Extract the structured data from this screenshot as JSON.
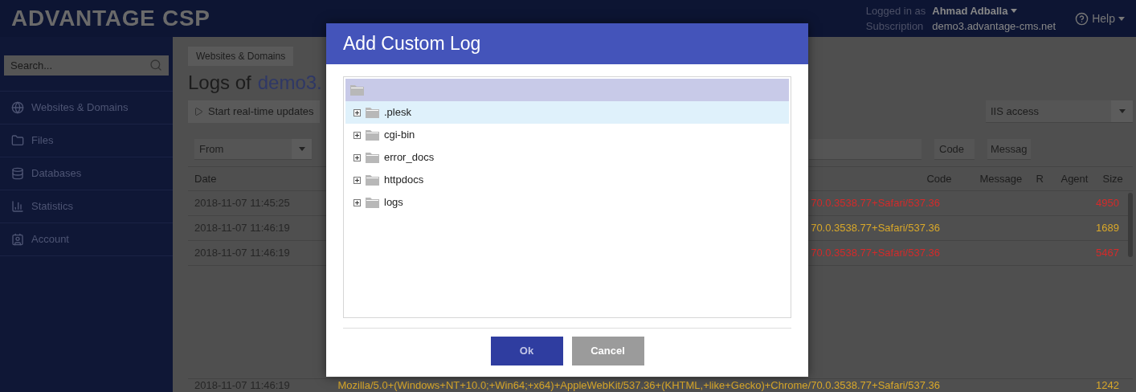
{
  "header": {
    "logo": "ADVANTAGE CSP",
    "logged_in_label": "Logged in as",
    "user": "Ahmad Adballa",
    "subscription_label": "Subscription",
    "subscription": "demo3.advantage-cms.net",
    "help": "Help"
  },
  "sidebar": {
    "search_placeholder": "Search...",
    "items": [
      {
        "label": "Websites & Domains"
      },
      {
        "label": "Files"
      },
      {
        "label": "Databases"
      },
      {
        "label": "Statistics"
      },
      {
        "label": "Account"
      }
    ]
  },
  "breadcrumb": "Websites & Domains",
  "title": {
    "prefix": "Logs of",
    "domain": "demo3."
  },
  "toolbar": {
    "realtime_button": "Start real-time updates",
    "log_select": "IIS access"
  },
  "filters": {
    "from_placeholder": "From",
    "code_placeholder": "Code",
    "message_placeholder": "Messag"
  },
  "table": {
    "columns": [
      "Date",
      "Code",
      "Message",
      "R",
      "Agent",
      "Size"
    ],
    "rows": [
      {
        "date": "2018-11-07 11:45:25",
        "agent": "70.0.3538.77+Safari/537.36",
        "size": "4950",
        "color": "#d42a2a"
      },
      {
        "date": "2018-11-07 11:46:19",
        "agent": "70.0.3538.77+Safari/537.36",
        "size": "1689",
        "color": "#d9a82a"
      },
      {
        "date": "2018-11-07 11:46:19",
        "agent": "70.0.3538.77+Safari/537.36",
        "size": "5467",
        "color": "#d42a2a"
      },
      {
        "date": "2018-11-07 11:46:19",
        "agent": "Mozilla/5.0+(Windows+NT+10.0;+Win64;+x64)+AppleWebKit/537.36+(KHTML,+like+Gecko)+Chrome/70.0.3538.77+Safari/537.36",
        "size": "1242",
        "color": "#d9a82a"
      }
    ]
  },
  "dialog": {
    "title": "Add Custom Log",
    "tree": {
      "root": {
        "selected": false
      },
      "children": [
        {
          "label": ".plesk",
          "selected": true,
          "expanded": false
        },
        {
          "label": "cgi-bin",
          "selected": false,
          "expanded": false
        },
        {
          "label": "error_docs",
          "selected": false,
          "expanded": false
        },
        {
          "label": "httpdocs",
          "selected": false,
          "expanded": false
        },
        {
          "label": "logs",
          "selected": false,
          "expanded": false
        }
      ]
    },
    "buttons": [
      {
        "label": "Ok",
        "kind": "primary"
      },
      {
        "label": "Cancel",
        "kind": "secondary"
      }
    ]
  }
}
